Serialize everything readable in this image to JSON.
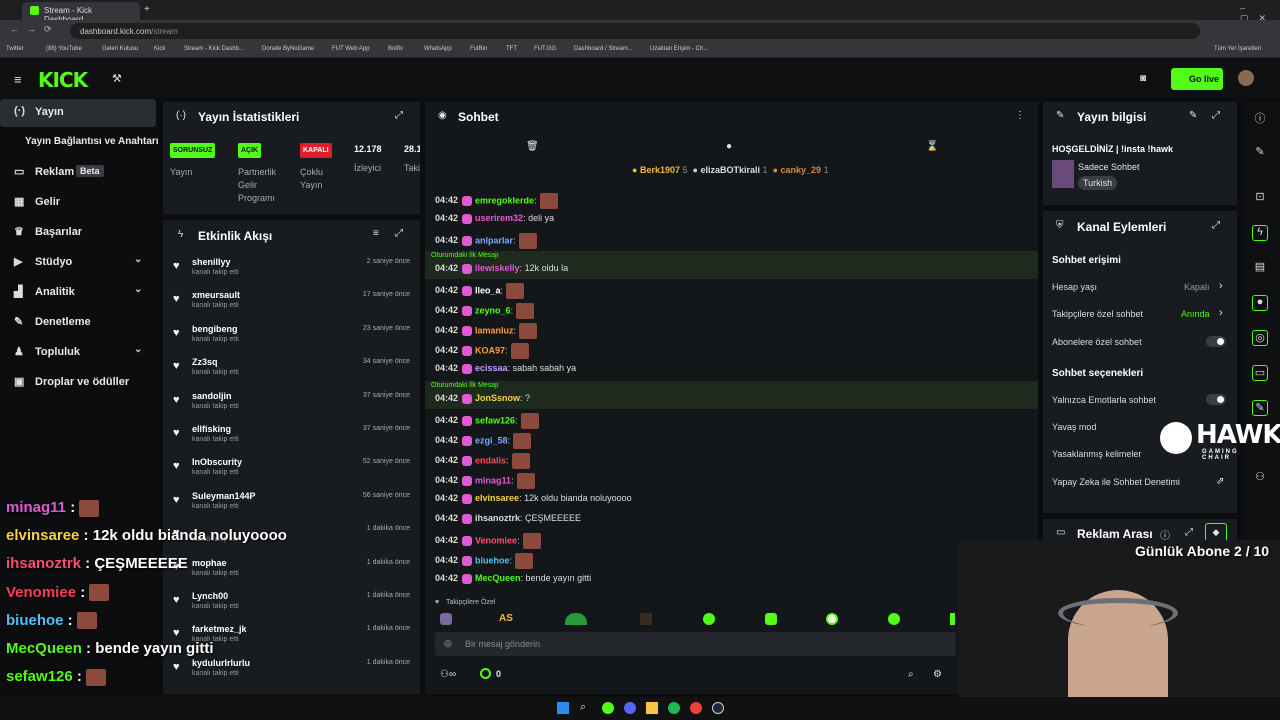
{
  "browser": {
    "tab_title": "Stream - Kick Dashboard",
    "url_host": "dashboard.kick.com",
    "url_path": "/stream",
    "bookmarks": [
      "Twitter",
      "(88) YouTube",
      "Gelen Kutusu",
      "Kick",
      "Stream - Kick Dashb...",
      "Donate ByNoGame",
      "FUT Web App",
      "Botfix",
      "WhatsApp",
      "FutBin",
      "TFT",
      "FUT.GG",
      "Dashboard / Stream...",
      "Uzaktan Erişim - Ch..."
    ],
    "all_bookmarks": "Tüm Yer İşaretleri"
  },
  "header": {
    "logo": "KICK",
    "go_live": "Go live"
  },
  "sidebar": {
    "items": [
      {
        "label": "Yayın"
      },
      {
        "label": "Yayın Bağlantısı ve Anahtarı"
      },
      {
        "label": "Reklam",
        "badge": "Beta"
      },
      {
        "label": "Gelir"
      },
      {
        "label": "Başarılar"
      },
      {
        "label": "Stüdyo"
      },
      {
        "label": "Analitik"
      },
      {
        "label": "Denetleme"
      },
      {
        "label": "Topluluk"
      },
      {
        "label": "Droplar ve ödüller"
      }
    ]
  },
  "stats": {
    "title": "Yayın İstatistikleri",
    "items": [
      {
        "badge": "SORUNSUZ",
        "label": "Yayın"
      },
      {
        "badge": "AÇIK",
        "label": "Partnerlik Gelir Programı"
      },
      {
        "badge": "KAPALI",
        "label": "Çoklu Yayın"
      },
      {
        "value": "12.178",
        "label": "İzleyici"
      },
      {
        "value": "28.1",
        "label": "Taki"
      }
    ],
    "colors": {
      "green": "#53fc18",
      "red": "#e01e2e"
    }
  },
  "activity": {
    "title": "Etkinlik Akışı",
    "sub": "kanalı takip etti",
    "items": [
      {
        "name": "shenillyy",
        "time": "2 saniye önce"
      },
      {
        "name": "xmeursault",
        "time": "17 saniye önce"
      },
      {
        "name": "bengibeng",
        "time": "23 saniye önce"
      },
      {
        "name": "Zz3sq",
        "time": "34 saniye önce"
      },
      {
        "name": "sandoljin",
        "time": "37 saniye önce"
      },
      {
        "name": "ellfisking",
        "time": "37 saniye önce"
      },
      {
        "name": "InObscurity",
        "time": "52 saniye önce"
      },
      {
        "name": "Suleyman144P",
        "time": "56 saniye önce"
      },
      {
        "name": "",
        "time": "1 dakika önce"
      },
      {
        "name": "mophae",
        "time": "1 dakika önce"
      },
      {
        "name": "Lynch00",
        "time": "1 dakika önce"
      },
      {
        "name": "farketmez_jk",
        "time": "1 dakika önce"
      },
      {
        "name": "kydulurlrlurlu",
        "time": "1 dakika önce"
      }
    ]
  },
  "chat": {
    "title": "Sohbet",
    "top_users": [
      {
        "name": "Berk1907",
        "count": "5"
      },
      {
        "name": "elizaBOTkirali",
        "count": "1"
      },
      {
        "name": "canky_29",
        "count": "1"
      }
    ],
    "first_msg_label": "Oturumdaki İlk Mesajı",
    "messages": [
      {
        "time": "04:42",
        "user": "emregoklerde",
        "color": "#53fc18",
        "text": ":"
      },
      {
        "time": "04:42",
        "user": "userirem32",
        "color": "#e05ad6",
        "text": ": deli ya"
      },
      {
        "time": "04:42",
        "user": "anlparlar",
        "color": "#7aa7ff",
        "text": ":"
      },
      {
        "time": "04:42",
        "user": "ilewiskelly",
        "color": "#e05ad6",
        "text": ": 12k oldu la"
      },
      {
        "time": "04:42",
        "user": "lleo_a",
        "color": "#ffffff",
        "text": ":"
      },
      {
        "time": "04:42",
        "user": "zeyno_6",
        "color": "#53fc18",
        "text": ":"
      },
      {
        "time": "04:42",
        "user": "lamanluz",
        "color": "#ff9b3d",
        "text": ":"
      },
      {
        "time": "04:42",
        "user": "KOA97",
        "color": "#ff9b3d",
        "text": ":"
      },
      {
        "time": "04:42",
        "user": "ecissaa",
        "color": "#c69bff",
        "text": ": sabah sabah ya"
      },
      {
        "time": "04:42",
        "user": "JonSsnow",
        "color": "#f5d442",
        "text": ": ?"
      },
      {
        "time": "04:42",
        "user": "sefaw126",
        "color": "#53fc18",
        "text": ":"
      },
      {
        "time": "04:42",
        "user": "ezgi_58",
        "color": "#7aa7ff",
        "text": ":"
      },
      {
        "time": "04:42",
        "user": "endalis",
        "color": "#ff4d4d",
        "text": ":"
      },
      {
        "time": "04:42",
        "user": "minag11",
        "color": "#e05ad6",
        "text": ":"
      },
      {
        "time": "04:42",
        "user": "elvinsaree",
        "color": "#f5d442",
        "text": ": 12k oldu bianda noluyoooo"
      },
      {
        "time": "04:42",
        "user": "ihsanoztrk",
        "color": "#dddddd",
        "text": ": ÇEŞMEEEEE"
      },
      {
        "time": "04:42",
        "user": "Venomiee",
        "color": "#ff4d6d",
        "text": ":"
      },
      {
        "time": "04:42",
        "user": "biuehoe",
        "color": "#4fc3f7",
        "text": ":"
      },
      {
        "time": "04:42",
        "user": "MecQueen",
        "color": "#53fc18",
        "text": ": bende yayın gitti"
      }
    ],
    "followers_only": "Takipçilere Özel",
    "input_placeholder": "Bir mesaj gönderin",
    "counter": "0"
  },
  "stream_info": {
    "title": "Yayın bilgisi",
    "stream_title": "HOŞGELDİNİZ | !insta !hawk",
    "category": "Sadece Sohbet",
    "language": "Turkish"
  },
  "channel_actions": {
    "title": "Kanal Eylemleri",
    "chat_access": "Sohbet erişimi",
    "account_age": "Hesap yaşı",
    "account_age_val": "Kapalı",
    "followers_only": "Takipçilere özel sohbet",
    "followers_only_val": "Anında",
    "subs_only": "Abonelere özel sohbet",
    "chat_options": "Sohbet seçenekleri",
    "emotes_only": "Yalnızca Emotlarla sohbet",
    "slow_mode": "Yavaş mod",
    "banned_words": "Yasaklanmış kelimeler",
    "ai_moderation": "Yapay Zeka ile Sohbet Denetimi"
  },
  "ad_break": {
    "title": "Reklam Arası"
  },
  "overlay": {
    "sub_goal": "Günlük Abone 2 / 10",
    "brand": "HAWK",
    "brand_sub": "GAMING CHAIR",
    "lines": [
      {
        "user": "minag11",
        "text": " :",
        "color": "#e05ad6"
      },
      {
        "user": "elvinsaree",
        "text": " : 12k oldu bianda noluyoooo",
        "color": "#f5d442"
      },
      {
        "user": "ihsanoztrk",
        "text": " : ÇEŞMEEEEE",
        "color": "#ff4d6d"
      },
      {
        "user": "Venomiee",
        "text": " :",
        "color": "#ff3d5a"
      },
      {
        "user": "biuehoe",
        "text": " :",
        "color": "#4fc3f7"
      },
      {
        "user": "MecQueen",
        "text": " : bende yayın gitti",
        "color": "#53fc18"
      },
      {
        "user": "sefaw126",
        "text": " :",
        "color": "#53fc18"
      }
    ]
  }
}
